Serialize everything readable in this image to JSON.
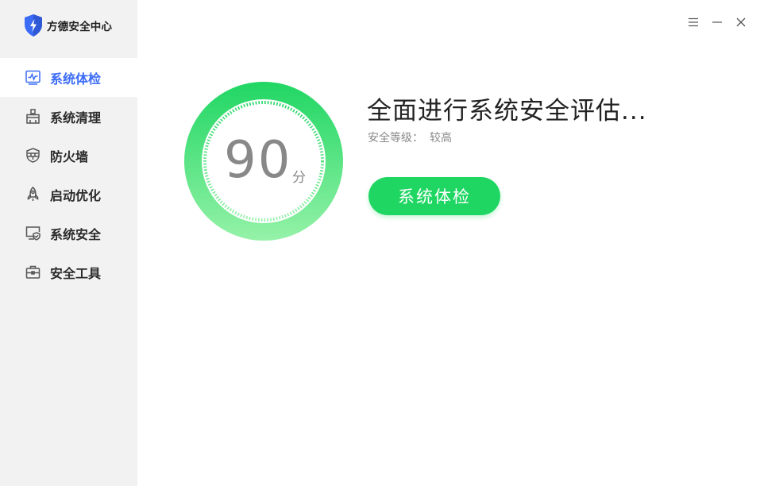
{
  "app": {
    "name": "方德安全中心",
    "logo_icon": "shield-bolt-icon",
    "accent": "#3b6cf6"
  },
  "window_controls": [
    {
      "name": "menu-icon"
    },
    {
      "name": "minimize-icon"
    },
    {
      "name": "close-icon"
    }
  ],
  "sidebar": {
    "items": [
      {
        "label": "系统体检",
        "icon": "health-check-icon",
        "active": true
      },
      {
        "label": "系统清理",
        "icon": "cleanup-icon",
        "active": false
      },
      {
        "label": "防火墙",
        "icon": "firewall-icon",
        "active": false
      },
      {
        "label": "启动优化",
        "icon": "rocket-icon",
        "active": false
      },
      {
        "label": "系统安全",
        "icon": "system-security-icon",
        "active": false
      },
      {
        "label": "安全工具",
        "icon": "toolbox-icon",
        "active": false
      }
    ]
  },
  "main": {
    "score": "90",
    "score_unit": "分",
    "status_title": "全面进行系统安全评估...",
    "level_label": "安全等级：",
    "level_value": "较高",
    "check_button_label": "系统体检",
    "dial_color": "#20d663",
    "button_color": "#20d663"
  }
}
